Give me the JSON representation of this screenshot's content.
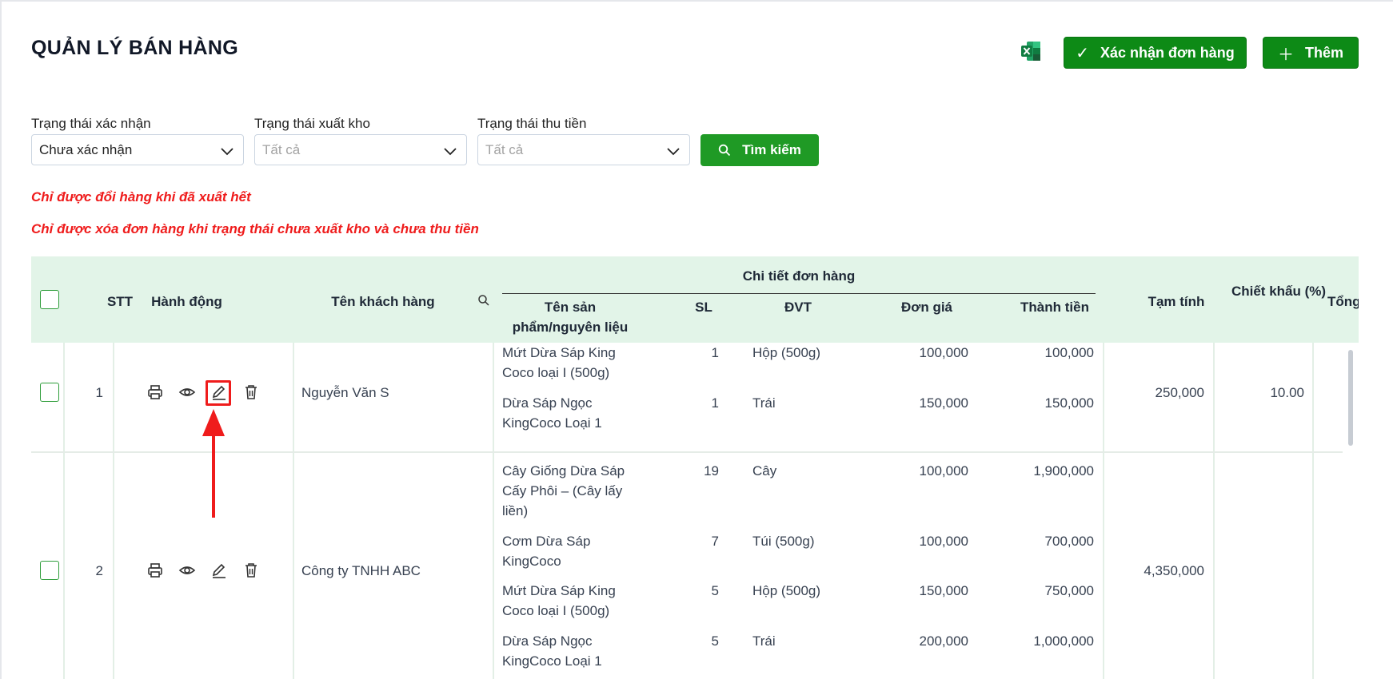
{
  "page": {
    "title": "QUẢN LÝ BÁN HÀNG"
  },
  "toolbar": {
    "excel_icon": "excel-icon",
    "confirm_label": "Xác nhận đơn hàng",
    "add_label": "Thêm"
  },
  "filters": {
    "confirm_status": {
      "label": "Trạng thái xác nhận",
      "value": "Chưa xác nhận"
    },
    "export_status": {
      "label": "Trạng thái xuất kho",
      "placeholder": "Tất cả"
    },
    "payment_status": {
      "label": "Trạng thái thu tiền",
      "placeholder": "Tất cả"
    },
    "search_label": "Tìm kiếm"
  },
  "warnings": [
    "Chỉ được đổi hàng khi đã xuất hết",
    "Chỉ được xóa đơn hàng khi trạng thái chưa xuất kho và chưa thu tiền"
  ],
  "table": {
    "headers": {
      "stt": "STT",
      "action": "Hành động",
      "customer": "Tên khách hàng",
      "detail_group": "Chi tiết đơn hàng",
      "product": "Tên sản phẩm/nguyên liệu",
      "qty": "SL",
      "unit": "ĐVT",
      "price": "Đơn giá",
      "amount": "Thành tiền",
      "subtotal": "Tạm tính",
      "discount": "Chiết khấu (%)",
      "total": "Tổng"
    },
    "rows": [
      {
        "stt": "1",
        "customer": "Nguyễn Văn S",
        "subtotal": "250,000",
        "discount": "10.00",
        "items": [
          {
            "product": "Mứt Dừa Sáp King Coco loại I (500g)",
            "qty": "1",
            "unit": "Hộp (500g)",
            "price": "100,000",
            "amount": "100,000"
          },
          {
            "product": "Dừa Sáp Ngọc KingCoco Loại 1",
            "qty": "1",
            "unit": "Trái",
            "price": "150,000",
            "amount": "150,000"
          }
        ]
      },
      {
        "stt": "2",
        "customer": "Công ty TNHH ABC",
        "subtotal": "4,350,000",
        "discount": "",
        "items": [
          {
            "product": "Cây Giống Dừa Sáp Cấy Phôi – (Cây lấy liền)",
            "qty": "19",
            "unit": "Cây",
            "price": "100,000",
            "amount": "1,900,000"
          },
          {
            "product": "Cơm Dừa Sáp KingCoco",
            "qty": "7",
            "unit": "Túi (500g)",
            "price": "100,000",
            "amount": "700,000"
          },
          {
            "product": "Mứt Dừa Sáp King Coco loại I (500g)",
            "qty": "5",
            "unit": "Hộp (500g)",
            "price": "150,000",
            "amount": "750,000"
          },
          {
            "product": "Dừa Sáp Ngọc KingCoco Loại 1",
            "qty": "5",
            "unit": "Trái",
            "price": "200,000",
            "amount": "1,000,000"
          }
        ]
      }
    ]
  },
  "colors": {
    "primary_green": "#0d8a16",
    "header_bg": "#e2f4e8",
    "warning_red": "#ef1c1c"
  }
}
